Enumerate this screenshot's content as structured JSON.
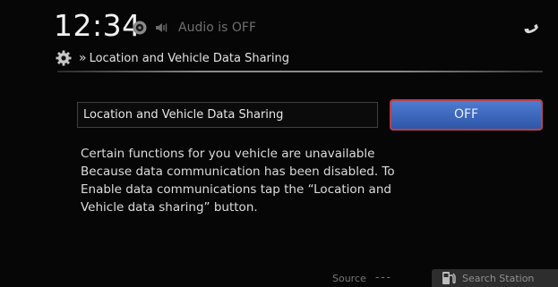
{
  "status_bar": {
    "time": "12:34",
    "audio_status": "Audio is OFF",
    "icons": [
      "clock-settings-icon",
      "audio-muted-icon",
      "phone-icon"
    ]
  },
  "breadcrumb": {
    "icon": "gear-icon",
    "separator": "»",
    "title": "Location and Vehicle Data Sharing"
  },
  "setting": {
    "label": "Location and Vehicle Data Sharing",
    "toggle_value": "OFF",
    "description_lines": [
      "Certain functions for you vehicle are unavailable",
      "Because data communication has been disabled. To",
      "Enable data communications tap the “Location and",
      "Vehicle data sharing” button."
    ]
  },
  "bottom_bar": {
    "source_label": "Source",
    "source_value": "---",
    "search_station_label": "Search Station",
    "search_station_icon": "fuel-pump-icon"
  },
  "colors": {
    "toggle_fill": "#3e6bc0",
    "toggle_border": "#b9414c",
    "background": "#060606"
  }
}
